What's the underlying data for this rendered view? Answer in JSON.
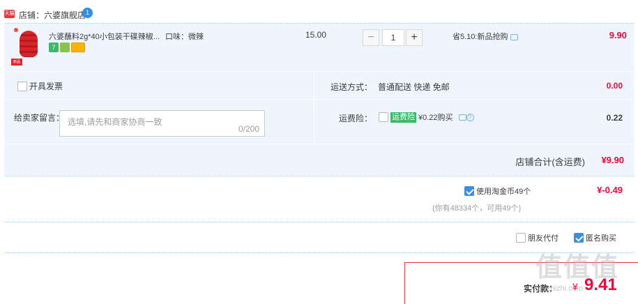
{
  "store": {
    "label": "店铺：六婆旗舰店",
    "tmall_icon": "tmall-icon",
    "chat_icon": "wangwang-icon",
    "chat_badge": "1"
  },
  "item": {
    "title": "六婆蘸料2g*40小包装干碟辣椒...",
    "flavor": "口味：微辣",
    "unit_price": "15.00",
    "quantity": "1",
    "qty_minus": "−",
    "qty_plus": "+",
    "promo": "省5.10:新品抢购",
    "total": "9.90",
    "badge1": "7"
  },
  "options": {
    "invoice_label": "开具发票",
    "shipping_label": "运送方式：",
    "shipping_value": "普通配送 快递 免邮",
    "shipping_price": "0.00",
    "message_label": "给卖家留言：",
    "message_placeholder": "选填,请先和商家协商一致",
    "message_count": "0/200",
    "insurance_label": "运费险：",
    "insurance_tag": "运费险",
    "insurance_text": "¥0.22购买",
    "insurance_price": "0.22"
  },
  "store_total": {
    "label": "店铺合计(含运费)",
    "value": "¥9.90"
  },
  "coins": {
    "label": "使用淘金币49个",
    "note": "(你有48334个，可用49个)",
    "value": "¥-0.49"
  },
  "purchase": {
    "friend_pay": "朋友代付",
    "anonymous": "匿名购买"
  },
  "pay": {
    "label": "实付款：",
    "currency": "¥",
    "amount": "9.41"
  },
  "watermark": {
    "big": "值值值",
    "small": "zhizhizhi.com"
  }
}
